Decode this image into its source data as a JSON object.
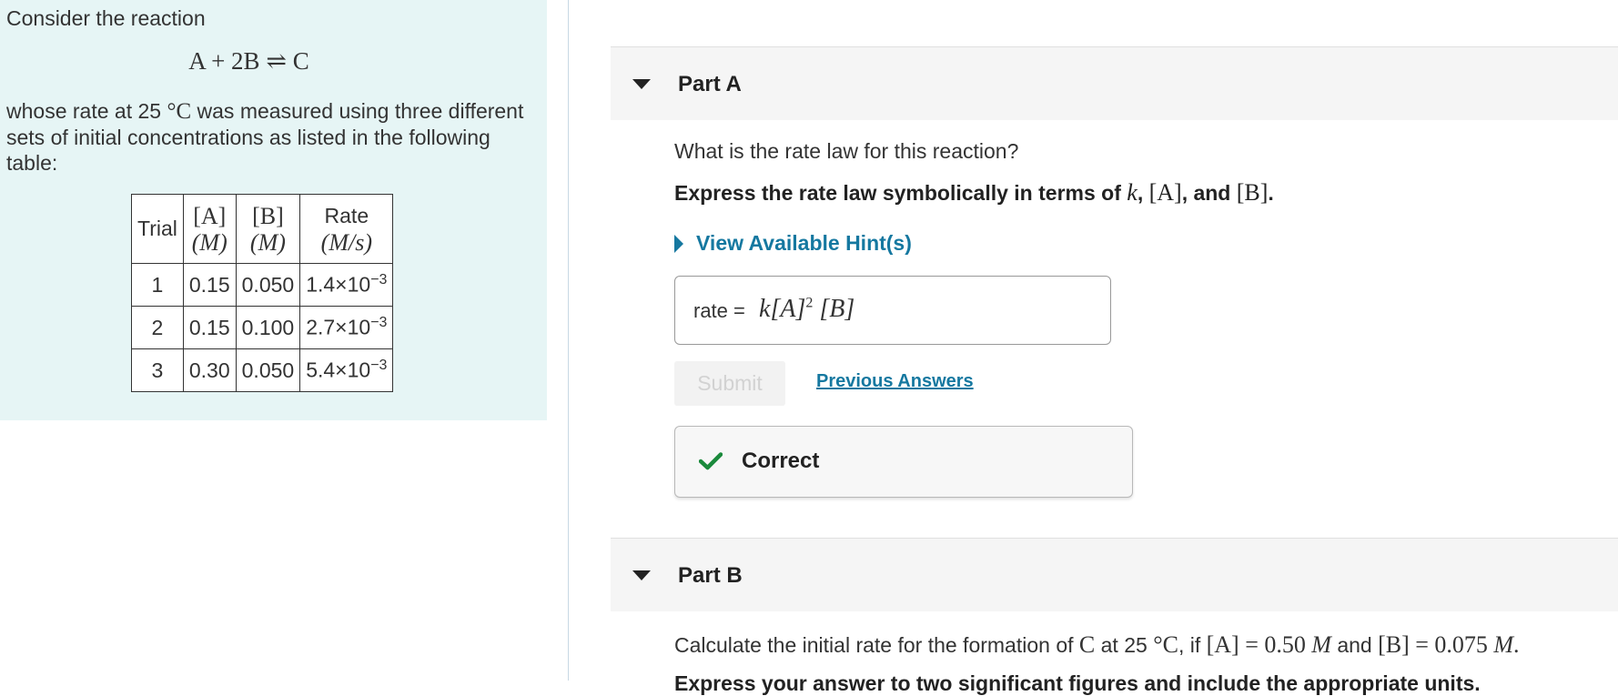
{
  "problem": {
    "intro": "Consider the reaction",
    "reaction": {
      "lhs_a": "A",
      "plus": "+",
      "coef_b": "2B",
      "arrow": "⇌",
      "rhs": "C"
    },
    "description_before": "whose rate at 25",
    "temperature_unit": "°C",
    "description_after": "was measured using three different sets of initial concentrations as listed in the following table:",
    "table": {
      "headers": {
        "trial": "Trial",
        "a_species": "[A]",
        "a_unit": "(M)",
        "b_species": "[B]",
        "b_unit": "(M)",
        "rate_label": "Rate",
        "rate_unit": "(M/s)"
      },
      "rows": [
        {
          "trial": "1",
          "a": "0.15",
          "b": "0.050",
          "rate_mantissa": "1.4×10",
          "rate_exp": "−3"
        },
        {
          "trial": "2",
          "a": "0.15",
          "b": "0.100",
          "rate_mantissa": "2.7×10",
          "rate_exp": "−3"
        },
        {
          "trial": "3",
          "a": "0.30",
          "b": "0.050",
          "rate_mantissa": "5.4×10",
          "rate_exp": "−3"
        }
      ]
    }
  },
  "part_a": {
    "title": "Part A",
    "question": "What is the rate law for this reaction?",
    "instruction_before": "Express the rate law symbolically in terms of",
    "instruction_k": "k",
    "instruction_comma1": ",",
    "instruction_a": "[A]",
    "instruction_and": ", and",
    "instruction_b": "[B]",
    "instruction_end": ".",
    "hint_label": "View Available Hint(s)",
    "answer_label": "rate =",
    "answer_k": "k",
    "answer_a": "[A]",
    "answer_exp": "2",
    "answer_b": "[B]",
    "submit_label": "Submit",
    "previous_answers_label": "Previous Answers",
    "feedback": "Correct"
  },
  "part_b": {
    "title": "Part B",
    "q1": "Calculate the initial rate for the formation of",
    "q_c": "C",
    "q2": "at 25",
    "q_unit": "°C",
    "q3": ", if",
    "q_a": "[A] = 0.50",
    "q_m1": "M",
    "q4": "and",
    "q_b": "[B] = 0.075",
    "q_m2": "M",
    "q5": ".",
    "cutoff": "Express your answer to two significant figures and include the appropriate units."
  },
  "colors": {
    "panel_bg": "#e6f5f5",
    "link": "#1578a0",
    "check": "#1b8a3c",
    "part_header_bg": "#f5f5f5"
  },
  "icons": [
    "caret-down-icon",
    "caret-right-icon",
    "checkmark-icon"
  ]
}
